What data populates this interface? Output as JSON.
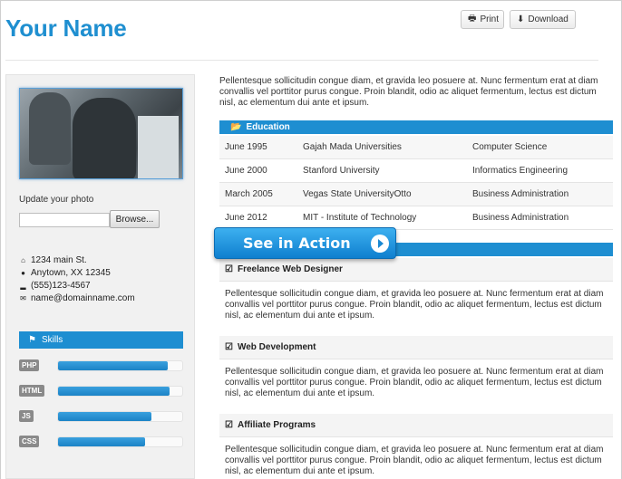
{
  "header": {
    "name": "Your Name",
    "print_label": "Print",
    "download_label": "Download"
  },
  "sidebar": {
    "update_photo_label": "Update your photo",
    "browse_label": "Browse...",
    "contact": {
      "address": "1234 main St.",
      "city": "Anytown, XX 12345",
      "phone": "(555)123-4567",
      "email": "name@domainname.com"
    },
    "skills_title": "Skills",
    "skills": [
      {
        "name": "PHP",
        "level": 0.88
      },
      {
        "name": "HTML",
        "level": 0.9
      },
      {
        "name": "JS",
        "level": 0.75
      },
      {
        "name": "CSS",
        "level": 0.7
      }
    ]
  },
  "main": {
    "intro": "Pellentesque sollicitudin congue diam, et gravida leo posuere at. Nunc fermentum erat at diam convallis vel porttitor purus congue. Proin blandit, odio ac aliquet fermentum, lectus est dictum nisl, ac elementum dui ante et ipsum.",
    "education_title": "Education",
    "education": [
      {
        "date": "June 1995",
        "school": "Gajah Mada Universities",
        "field": "Computer Science"
      },
      {
        "date": "June 2000",
        "school": "Stanford University",
        "field": "Informatics Engineering"
      },
      {
        "date": "March 2005",
        "school": "Vegas State UniversityOtto",
        "field": "Business Administration"
      },
      {
        "date": "June 2012",
        "school": "MIT - Institute of Technology",
        "field": "Business Administration"
      }
    ],
    "jobs": [
      {
        "title": "Freelance Web Designer",
        "desc": "Pellentesque sollicitudin congue diam, et gravida leo posuere at. Nunc fermentum erat at diam convallis vel porttitor purus congue. Proin blandit, odio ac aliquet fermentum, lectus est dictum nisl, ac elementum dui ante et ipsum."
      },
      {
        "title": "Web Development",
        "desc": "Pellentesque sollicitudin congue diam, et gravida leo posuere at. Nunc fermentum erat at diam convallis vel porttitor purus congue. Proin blandit, odio ac aliquet fermentum, lectus est dictum nisl, ac elementum dui ante et ipsum."
      },
      {
        "title": "Affiliate Programs",
        "desc": "Pellentesque sollicitudin congue diam, et gravida leo posuere at. Nunc fermentum erat at diam convallis vel porttitor purus congue. Proin blandit, odio ac aliquet fermentum, lectus est dictum nisl, ac elementum dui ante et ipsum."
      }
    ]
  },
  "overlay": {
    "see_in_action_label": "See in Action"
  },
  "icons": {
    "print": "printer-icon",
    "download": "download-icon",
    "folder": "folder-open-icon",
    "home": "home-icon",
    "location": "map-marker-icon",
    "phone": "signal-icon",
    "email": "envelope-icon",
    "tag": "tag-icon",
    "check": "check-square-icon",
    "play": "play-circle-icon"
  },
  "colors": {
    "accent": "#1e8ed1",
    "title": "#1f8fd0"
  }
}
